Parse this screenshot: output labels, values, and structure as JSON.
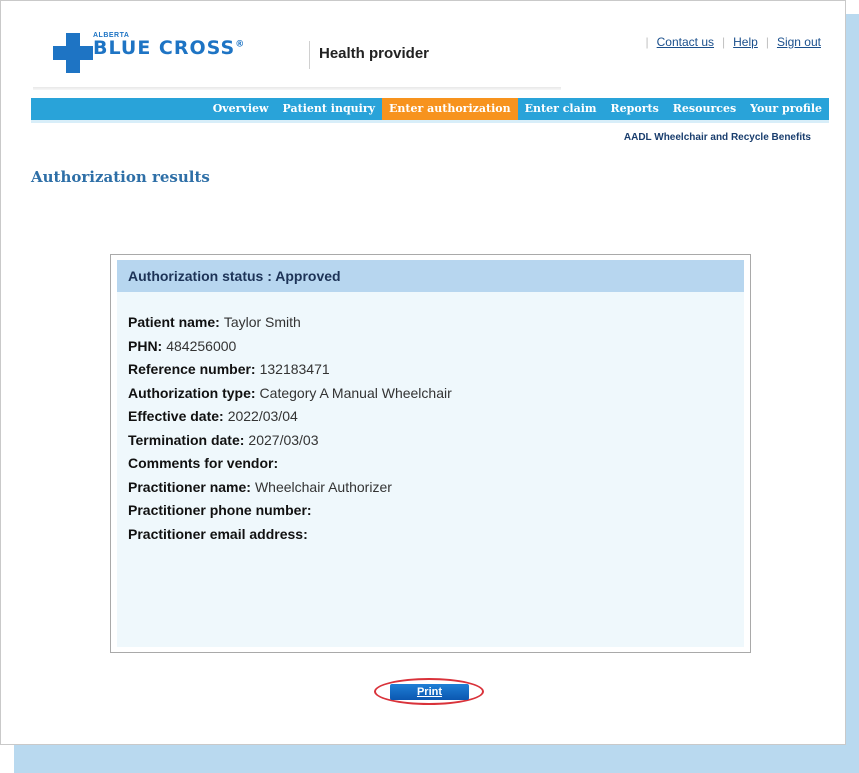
{
  "header": {
    "logo_small": "ALBERTA",
    "logo_big": "BLUE CROSS",
    "logo_reg": "®",
    "title": "Health provider",
    "links": [
      "Contact us",
      "Help",
      "Sign out"
    ]
  },
  "nav": {
    "items": [
      "Overview",
      "Patient inquiry",
      "Enter authorization",
      "Enter claim",
      "Reports",
      "Resources",
      "Your profile"
    ],
    "active": "Enter authorization",
    "sub_link": "AADL Wheelchair and Recycle Benefits"
  },
  "page": {
    "title": "Authorization results"
  },
  "results": {
    "status_label": "Authorization status : Approved",
    "fields": [
      {
        "label": "Patient name:",
        "value": "Taylor Smith"
      },
      {
        "label": "PHN:",
        "value": "484256000"
      },
      {
        "label": "Reference number:",
        "value": "132183471"
      },
      {
        "label": "Authorization type:",
        "value": "Category A Manual Wheelchair"
      },
      {
        "label": "Effective date:",
        "value": "2022/03/04"
      },
      {
        "label": "Termination date:",
        "value": "2027/03/03"
      },
      {
        "label": "Comments for vendor:",
        "value": ""
      },
      {
        "label": "Practitioner name:",
        "value": "Wheelchair Authorizer"
      },
      {
        "label": "Practitioner phone number:",
        "value": ""
      },
      {
        "label": "Practitioner email address:",
        "value": ""
      }
    ]
  },
  "actions": {
    "print_label": "Print"
  },
  "colors": {
    "brand_blue": "#1e74c4",
    "nav_blue": "#29a3d9",
    "nav_active": "#f7931e",
    "highlight_ring": "#d9323a"
  }
}
